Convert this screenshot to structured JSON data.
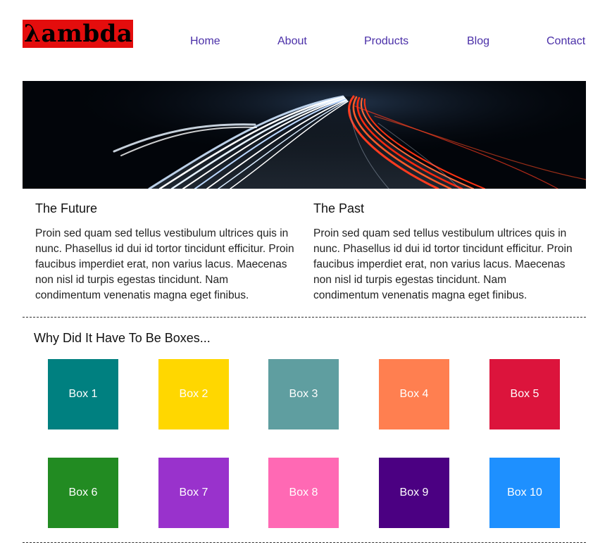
{
  "logo": {
    "symbol": "λ",
    "text": "ambda",
    "color": "#e40d0d"
  },
  "nav": {
    "items": [
      "Home",
      "About",
      "Products",
      "Blog",
      "Contact"
    ]
  },
  "columns": [
    {
      "title": "The Future",
      "body": "Proin sed quam sed tellus vestibulum ultrices quis in nunc. Phasellus id dui id tortor tincidunt efficitur. Proin faucibus imperdiet erat, non varius lacus. Maecenas non nisl id turpis egestas tincidunt. Nam condimentum venenatis magna eget finibus."
    },
    {
      "title": "The Past",
      "body": "Proin sed quam sed tellus vestibulum ultrices quis in nunc. Phasellus id dui id tortor tincidunt efficitur. Proin faucibus imperdiet erat, non varius lacus. Maecenas non nisl id turpis egestas tincidunt. Nam condimentum venenatis magna eget finibus."
    }
  ],
  "boxes_section": {
    "title": "Why Did It Have To Be Boxes...",
    "boxes": [
      {
        "label": "Box 1",
        "color": "#008080"
      },
      {
        "label": "Box 2",
        "color": "#ffd700"
      },
      {
        "label": "Box 3",
        "color": "#5f9ea0"
      },
      {
        "label": "Box 4",
        "color": "#ff7f50"
      },
      {
        "label": "Box 5",
        "color": "#dc143c"
      },
      {
        "label": "Box 6",
        "color": "#228b22"
      },
      {
        "label": "Box 7",
        "color": "#9932cc"
      },
      {
        "label": "Box 8",
        "color": "#ff69b4"
      },
      {
        "label": "Box 9",
        "color": "#4b0082"
      },
      {
        "label": "Box 10",
        "color": "#1e90ff"
      }
    ]
  }
}
